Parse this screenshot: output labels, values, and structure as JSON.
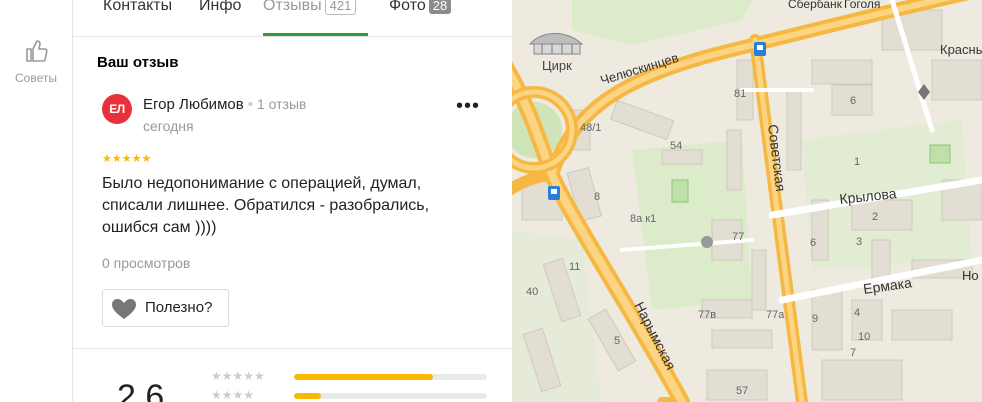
{
  "sidebar": {
    "tips_label": "Советы"
  },
  "tabs": [
    {
      "label": "Контакты"
    },
    {
      "label": "Инфо"
    },
    {
      "label": "Отзывы",
      "count": "421"
    },
    {
      "label": "Фото",
      "count": "28"
    }
  ],
  "active_tab": "Отзывы",
  "review": {
    "section_title": "Ваш отзыв",
    "avatar_initials": "ЕЛ",
    "author": "Егор Любимов",
    "author_reviews": "1 отзыв",
    "date": "сегодня",
    "stars": "★★★★★",
    "rating": 5,
    "text": "Было недопонимание с операцией, думал, списали лишнее. Обратился - разобрались, ошибся сам ))))",
    "views": "0 просмотров",
    "useful_label": "Полезно?",
    "more_icon": "more-dots-icon"
  },
  "summary": {
    "score": "2,6",
    "rows": [
      {
        "stars": "★★★★★",
        "fraction": 0.72
      },
      {
        "stars": "★★★★",
        "fraction": 0.14
      }
    ]
  },
  "map": {
    "labels": {
      "circus": "Цирк",
      "chelyuskintsev": "Челюскинцев",
      "sovetskaya": "Советская",
      "krylova": "Крылова",
      "ermaka": "Ермака",
      "narymskaya": "Нарымская",
      "sobervank": "Сбербанк",
      "gogolya": "Гоголя",
      "krasny": "Красны",
      "no": "Но"
    },
    "house_numbers": [
      "81",
      "48/1",
      "54",
      "6",
      "8",
      "8а к1",
      "77",
      "11",
      "40",
      "77в",
      "77а",
      "5",
      "57",
      "1",
      "2",
      "3",
      "4",
      "6",
      "7",
      "9",
      "10"
    ],
    "road_color": "#f6b843",
    "park_color": "#cfe5b8",
    "building_color": "#e3ded3",
    "bus_stop_color": "#2a7fd9"
  },
  "colors": {
    "accent_green": "#2e9e3b",
    "star_yellow": "#fcb800",
    "avatar_red": "#e8313b"
  }
}
